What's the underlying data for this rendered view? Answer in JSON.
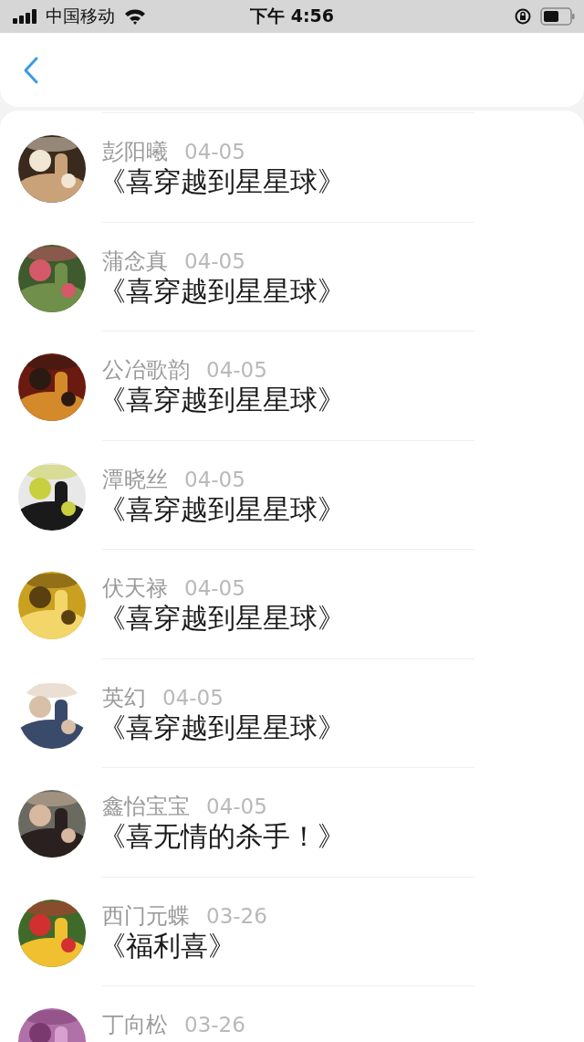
{
  "status_bar": {
    "carrier": "中国移动",
    "time": "下午 4:56"
  },
  "list": [
    {
      "name": "彭阳曦",
      "date": "04-05",
      "title": "《喜穿越到星星球》"
    },
    {
      "name": "蒲念真",
      "date": "04-05",
      "title": "《喜穿越到星星球》"
    },
    {
      "name": "公冶歌韵",
      "date": "04-05",
      "title": "《喜穿越到星星球》"
    },
    {
      "name": "潭晓丝",
      "date": "04-05",
      "title": "《喜穿越到星星球》"
    },
    {
      "name": "伏天禄",
      "date": "04-05",
      "title": "《喜穿越到星星球》"
    },
    {
      "name": "英幻",
      "date": "04-05",
      "title": "《喜穿越到星星球》"
    },
    {
      "name": "鑫怡宝宝",
      "date": "04-05",
      "title": "《喜无情的杀手！》"
    },
    {
      "name": "西门元蝶",
      "date": "03-26",
      "title": "《福利喜》"
    },
    {
      "name": "丁向松",
      "date": "03-26"
    }
  ]
}
